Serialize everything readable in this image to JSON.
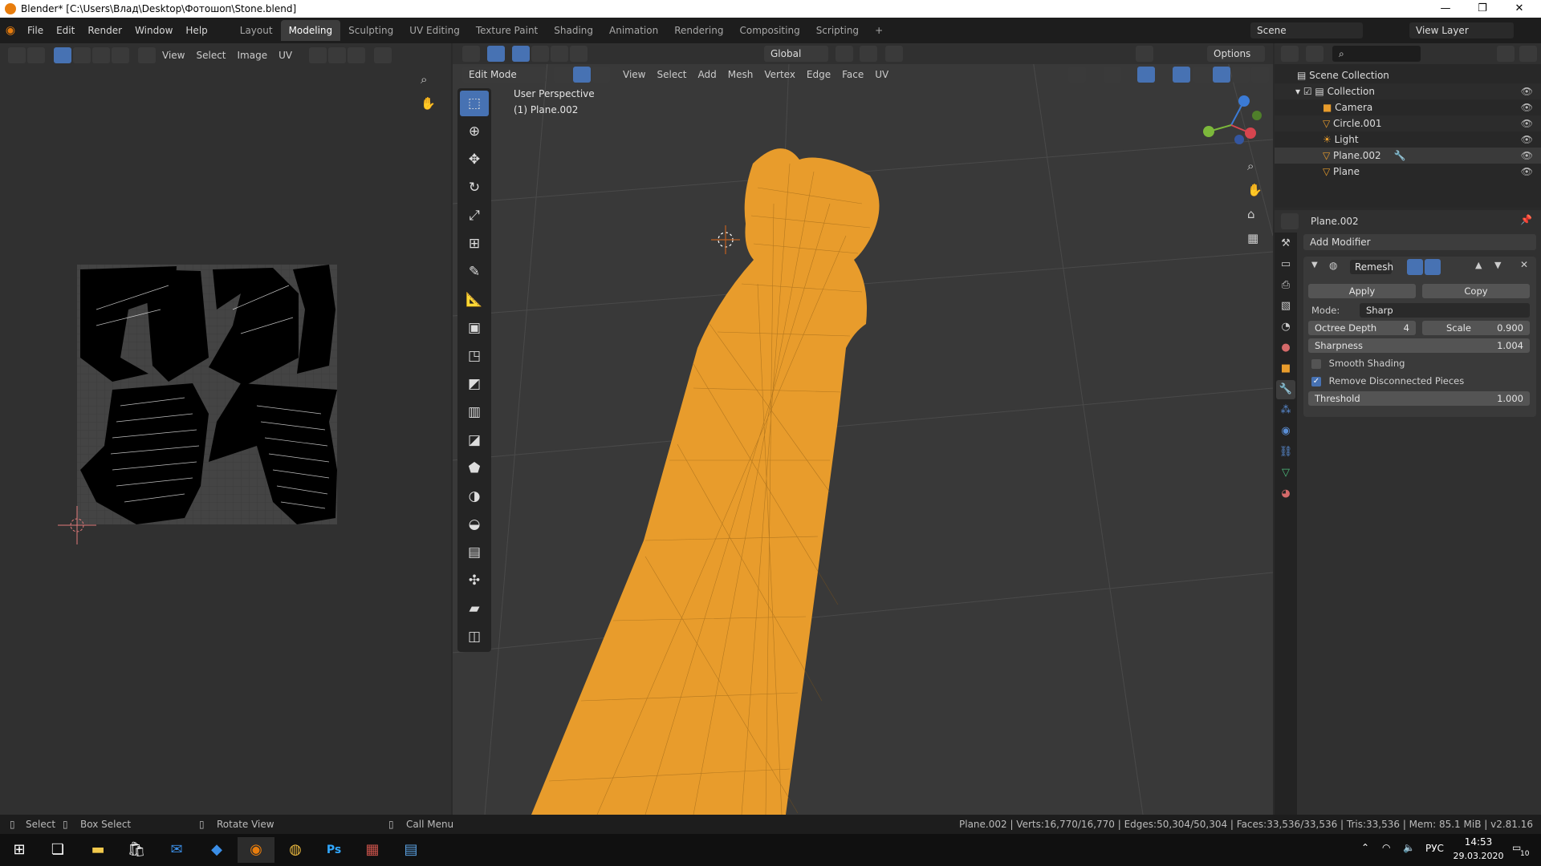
{
  "window": {
    "title": "Blender* [C:\\Users\\Влад\\Desktop\\Фотошоп\\Stone.blend]"
  },
  "menus": [
    "File",
    "Edit",
    "Render",
    "Window",
    "Help"
  ],
  "workspaces": [
    "Layout",
    "Modeling",
    "Sculpting",
    "UV Editing",
    "Texture Paint",
    "Shading",
    "Animation",
    "Rendering",
    "Compositing",
    "Scripting"
  ],
  "active_workspace": "Modeling",
  "scene": {
    "name": "Scene",
    "view_layer": "View Layer"
  },
  "uv_editor": {
    "menus": [
      "View",
      "Select",
      "Image",
      "UV"
    ]
  },
  "viewport": {
    "mode": "Edit Mode",
    "menus": [
      "View",
      "Select",
      "Add",
      "Mesh",
      "Vertex",
      "Edge",
      "Face",
      "UV"
    ],
    "transform_orientation": "Global",
    "options_label": "Options",
    "perspective_label": "User Perspective",
    "object_label": "(1) Plane.002",
    "mesh_color": "#e89c2c"
  },
  "outliner": {
    "root": "Scene Collection",
    "collection": "Collection",
    "items": [
      "Camera",
      "Circle.001",
      "Light",
      "Plane.002",
      "Plane"
    ]
  },
  "properties": {
    "object_name": "Plane.002",
    "add_modifier": "Add Modifier",
    "modifier_name": "Remesh",
    "apply_label": "Apply",
    "copy_label": "Copy",
    "mode_label": "Mode:",
    "mode_value": "Sharp",
    "octree_label": "Octree Depth",
    "octree_value": "4",
    "scale_label": "Scale",
    "scale_value": "0.900",
    "sharpness_label": "Sharpness",
    "sharpness_value": "1.004",
    "smooth_shading_label": "Smooth Shading",
    "smooth_shading": false,
    "remove_disconnected_label": "Remove Disconnected Pieces",
    "remove_disconnected": true,
    "threshold_label": "Threshold",
    "threshold_value": "1.000"
  },
  "status": {
    "select": "Select",
    "box_select": "Box Select",
    "rotate_view": "Rotate View",
    "call_menu": "Call Menu",
    "stats": "Plane.002 | Verts:16,770/16,770 | Edges:50,304/50,304 | Faces:33,536/33,536 | Tris:33,536 | Mem: 85.1 MiB | v2.81.16"
  },
  "taskbar": {
    "lang": "РУС",
    "time": "14:53",
    "date": "29.03.2020",
    "notifications": "10"
  }
}
